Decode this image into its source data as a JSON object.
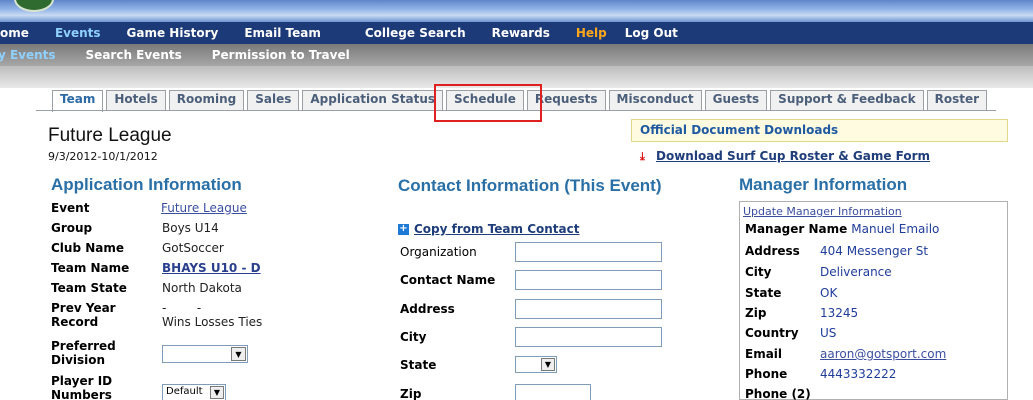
{
  "main_nav": [
    "Home",
    "Events",
    "Game History",
    "Email Team",
    "College Search",
    "Rewards",
    "Help",
    "Log Out"
  ],
  "sub_nav": [
    "My Events",
    "Search Events",
    "Permission to Travel"
  ],
  "tabs": [
    "Team",
    "Hotels",
    "Rooming",
    "Sales",
    "Application Status",
    "Schedule",
    "Requests",
    "Misconduct",
    "Guests",
    "Support & Feedback",
    "Roster"
  ],
  "league": {
    "name": "Future League",
    "dates": "9/3/2012-10/1/2012"
  },
  "downloads": {
    "title": "Official Document Downloads",
    "link": "Download Surf Cup Roster & Game Form"
  },
  "application": {
    "title": "Application Information",
    "rows": [
      {
        "label": "Event",
        "value": "Future League"
      },
      {
        "label": "Group",
        "value": "Boys U14"
      },
      {
        "label": "Club Name",
        "value": "GotSoccer"
      },
      {
        "label": "Team Name",
        "value": "BHAYS U10 - D"
      },
      {
        "label": "Team State",
        "value": "North Dakota"
      },
      {
        "label": "Prev Year Record",
        "value": "-        -\nWins Losses Ties"
      },
      {
        "label": "Preferred Division",
        "value": ""
      },
      {
        "label": "Player ID Numbers",
        "value": "Default"
      }
    ]
  },
  "contact": {
    "title": "Contact Information (This Event)",
    "copy_link": "Copy from Team Contact",
    "fields": [
      "Organization",
      "Contact Name",
      "Address",
      "City",
      "State",
      "Zip"
    ]
  },
  "manager": {
    "title": "Manager Information",
    "update_link": "Update Manager Information",
    "name_label": "Manager Name",
    "name_value": "Manuel Emailo",
    "rows": [
      {
        "label": "Address",
        "value": "404 Messenger St"
      },
      {
        "label": "City",
        "value": "Deliverance"
      },
      {
        "label": "State",
        "value": "OK"
      },
      {
        "label": "Zip",
        "value": "13245"
      },
      {
        "label": "Country",
        "value": "US"
      },
      {
        "label": "Email",
        "value": "aaron@gotsport.com"
      },
      {
        "label": "Phone",
        "value": "4443332222"
      },
      {
        "label": "Phone (2)",
        "value": ""
      }
    ]
  },
  "colors": {
    "nav_bg": "#1d3a78",
    "active_nav": "#8fd0ff",
    "help": "#ffa61a",
    "heading": "#2a6fa6",
    "highlight": "#e02020"
  }
}
